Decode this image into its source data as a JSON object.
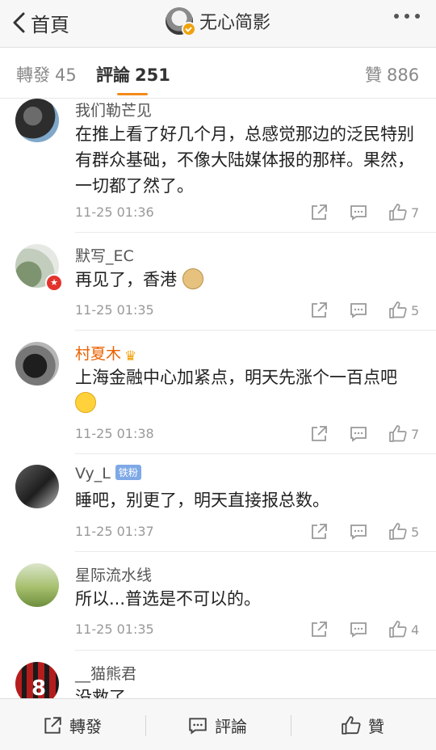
{
  "header": {
    "back_label": "首頁",
    "account_name": "无心简影"
  },
  "tabs": [
    {
      "label": "轉發",
      "count": "45"
    },
    {
      "label": "評論",
      "count": "251"
    },
    {
      "label": "贊",
      "count": "886"
    }
  ],
  "comments": [
    {
      "name": "我们勒芒见",
      "text": "在推上看了好几个月，总感觉那边的泛民特别有群众基础，不像大陆媒体报的那样。果然，一切都了然了。",
      "time": "11-25 01:36",
      "likes": "7"
    },
    {
      "name": "默写_EC",
      "text": "再见了，香港",
      "emoji": "doge",
      "time": "11-25 01:35",
      "likes": "5"
    },
    {
      "name": "村夏木",
      "text": "上海金融中心加紧点，明天先涨个一百点吧",
      "emoji": "cry",
      "time": "11-25 01:38",
      "likes": "7"
    },
    {
      "name": "Vy_L",
      "badge": "铁粉",
      "text": "睡吧，别更了，明天直接报总数。",
      "time": "11-25 01:37",
      "likes": "5"
    },
    {
      "name": "星际流水线",
      "text": "所以...普选是不可以的。",
      "time": "11-25 01:35",
      "likes": "4"
    },
    {
      "name": "__猫熊君",
      "text": "没救了",
      "avatar_text": "8"
    }
  ],
  "bottom_bar": {
    "repost_label": "轉發",
    "comment_label": "評論",
    "like_label": "贊"
  },
  "colors": {
    "accent_orange": "#f28b1c",
    "vip_name": "#eb6100",
    "fan_badge": "#7ea9e6"
  },
  "icons": [
    "chevron-left-icon",
    "more-icon",
    "share-icon",
    "comment-icon",
    "thumbs-up-icon",
    "crown-icon",
    "star-badge-icon"
  ]
}
